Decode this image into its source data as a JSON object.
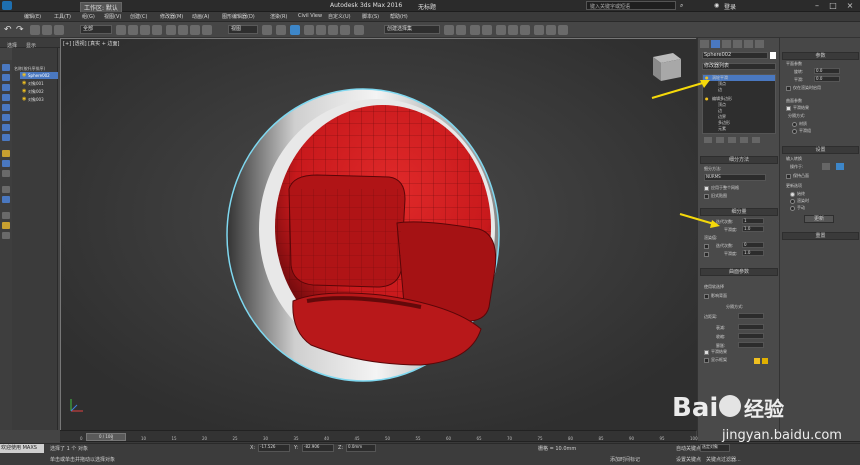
{
  "window": {
    "title_app": "Autodesk 3ds Max 2016",
    "title_file": "无标题",
    "workspace_label": "工作区: 默认",
    "search_placeholder": "键入关键字或短语",
    "login_label": "登录"
  },
  "menu": {
    "items": [
      "编辑(E)",
      "工具(T)",
      "组(G)",
      "视图(V)",
      "创建(C)",
      "修改器(M)",
      "动画(A)",
      "图形编辑器(D)",
      "渲染(R)",
      "Civil View",
      "自定义(U)",
      "脚本(S)",
      "帮助(H)"
    ]
  },
  "toolbar": {
    "selection_filter": "全部",
    "view_dropdown": "视图",
    "named_selection": "创建选择集"
  },
  "explorer": {
    "tabs": [
      "选择",
      "显示"
    ],
    "header": "名称(按升序排序)",
    "items": [
      "Sphere002",
      "对象001",
      "对象002",
      "对象003"
    ]
  },
  "viewport": {
    "label": "[+] [透视] [真实 + 边面]",
    "viewcube_label": "前"
  },
  "command_panel": {
    "object_name": "Sphere002",
    "modifier_list": "修改器列表",
    "stack": [
      "涡轮平滑",
      "顶点",
      "边",
      "编辑多边形",
      "顶点",
      "边",
      "边界",
      "多边形",
      "元素"
    ],
    "subdivision_method_title": "细分方法",
    "subdivision_method_label": "细分方法:",
    "subdivision_method_value": "NURMS",
    "apply_to_whole_mesh": "应用于整个网格",
    "old_style_mapping": "旧式贴图",
    "subdivision_amount_title": "细分量",
    "iterations_label": "迭代次数:",
    "iterations_value": "1",
    "smoothness_label": "平滑度:",
    "smoothness_value": "1.0",
    "render_values_label": "渲染值:",
    "render_iterations_label": "迭代次数:",
    "render_iterations_value": "0",
    "render_smoothness_label": "平滑度:",
    "render_smoothness_value": "1.0",
    "surface_params_title": "曲面参数",
    "smooth_result": "平滑结果",
    "separate_by": "分隔方式:",
    "materials": "材质",
    "smoothing_groups": "平滑组",
    "update_options": "更新选项",
    "softsel_title": "软选择",
    "use_softsel": "使用软选择",
    "edge_distance": "边距离:",
    "affect_backfacing": "影响背面",
    "falloff_label": "衰减:",
    "pinch_label": "收缩:",
    "bubble_label": "膨胀:",
    "show_cage": "显示框架"
  },
  "right_panel": {
    "params_title": "参数",
    "displacement_approx": "平面参数",
    "rotation_label": "旋转:",
    "rotation_value": "0.0",
    "smoothing_label": "平滑:",
    "smoothing_value": "0.0",
    "only_in_render": "仅在渲染时启用",
    "surface_params": "曲面参数",
    "smoothing_check": "平滑结果",
    "separate_by": "分隔方式:",
    "material_radio": "材质",
    "smooth_group_radio": "平滑组",
    "settings_title": "设置",
    "input_conversion": "输入转换",
    "operate_on": "操作于:",
    "keep_convex": "保持凸面",
    "update_options": "更新选项",
    "always": "始终",
    "when_rendering": "渲染时",
    "manually": "手动",
    "update_btn": "更新",
    "reset_title": "重置"
  },
  "timeline": {
    "frame_label": "0 / 100",
    "ticks": [
      "0",
      "5",
      "10",
      "15",
      "20",
      "25",
      "30",
      "35",
      "40",
      "45",
      "50",
      "55",
      "60",
      "65",
      "70",
      "75",
      "80",
      "85",
      "90",
      "95",
      "100"
    ]
  },
  "status": {
    "welcome": "欢迎使用 MAXS",
    "selected": "选择了 1 个 对象",
    "hint": "单击或单击并拖动以选择对象",
    "x_label": "X:",
    "x_value": "-17.526",
    "y_label": "Y:",
    "y_value": "-82.906",
    "z_label": "Z:",
    "z_value": "0.0mm",
    "grid": "栅格 = 10.0mm",
    "add_time_tag": "添加时间标记",
    "auto_key": "自动关键点",
    "selected_obj": "选定对象",
    "set_key": "设置关键点",
    "key_filter": "关键点过滤器..."
  },
  "watermark": {
    "brand_a": "Bai",
    "brand_b": "经验",
    "url": "jingyan.baidu.com"
  },
  "colors": {
    "sphere_red": "#c8191c",
    "rim": "#d8d8d8",
    "arrow": "#f5d90a",
    "selection_blue": "#4a78c0"
  }
}
